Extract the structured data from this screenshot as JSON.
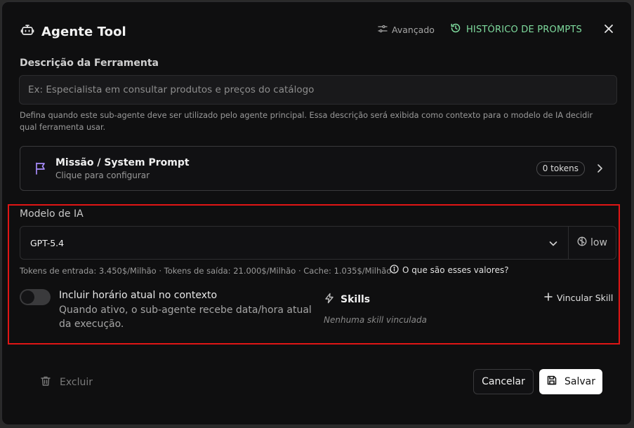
{
  "header": {
    "title": "Agente Tool",
    "advanced_label": "Avançado",
    "history_label": "HISTÓRICO DE PROMPTS"
  },
  "description": {
    "label": "Descrição da Ferramenta",
    "value": "",
    "placeholder": "Ex: Especialista em consultar produtos e preços do catálogo",
    "help": "Defina quando este sub-agente deve ser utilizado pelo agente principal. Essa descrição será exibida como contexto para o modelo de IA decidir qual ferramenta usar."
  },
  "mission": {
    "title": "Missão / System Prompt",
    "subtitle": "Clique para configurar",
    "tokens": "0 tokens"
  },
  "model": {
    "label": "Modelo de IA",
    "selected": "GPT-5.4",
    "effort": "low",
    "pricing": "Tokens de entrada: 3.450$/Milhão · Tokens de saída: 21.000$/Milhão · Cache: 1.035$/Milhão",
    "pricing_help": "O que são esses valores?"
  },
  "context_toggle": {
    "label": "Incluir horário atual no contexto",
    "description": "Quando ativo, o sub-agente recebe data/hora atual da execução.",
    "enabled": false
  },
  "skills": {
    "title": "Skills",
    "link_label": "Vincular Skill",
    "empty": "Nenhuma skill vinculada"
  },
  "footer": {
    "delete_label": "Excluir",
    "cancel_label": "Cancelar",
    "save_label": "Salvar"
  },
  "colors": {
    "accent_green": "#7fdc9e",
    "mission_icon": "#a78bfa",
    "highlight_border": "#e01515"
  }
}
